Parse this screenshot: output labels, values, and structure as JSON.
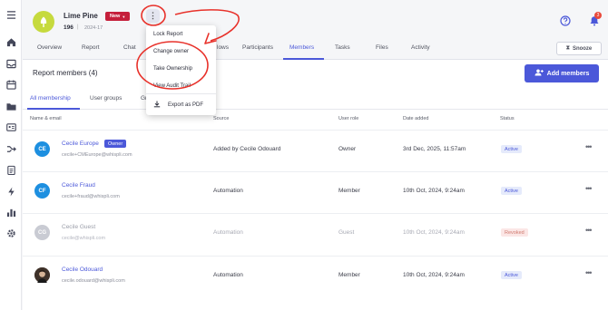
{
  "sidebar": {
    "icons": [
      "menu-icon",
      "home-icon",
      "inbox-icon",
      "calendar-icon",
      "folder-icon",
      "id-card-icon",
      "merge-icon",
      "clipboard-icon",
      "lightning-icon",
      "bar-chart-icon",
      "gear-icon"
    ]
  },
  "header": {
    "title": "Lime Pine",
    "badge": "New",
    "report_number": "196",
    "separator": "|",
    "report_date": "2024-17",
    "notification_count": "3"
  },
  "tabs": [
    {
      "label": "Overview"
    },
    {
      "label": "Report"
    },
    {
      "label": "Chat"
    },
    {
      "label": "lows"
    },
    {
      "label": "Participants"
    },
    {
      "label": "Members"
    },
    {
      "label": "Tasks"
    },
    {
      "label": "Files"
    },
    {
      "label": "Activity"
    }
  ],
  "snooze_label": "Snooze",
  "members": {
    "title": "Report members (4)",
    "add_button": "Add members",
    "subtabs": [
      {
        "label": "All membership"
      },
      {
        "label": "User groups"
      },
      {
        "label": "Gr"
      }
    ],
    "columns": [
      "Name & email",
      "Source",
      "User role",
      "Date added",
      "Status"
    ],
    "rows": [
      {
        "initials": "CE",
        "name": "Cecile Europe",
        "badge": "Owner",
        "email": "cecile+CMEurope@whispli.com",
        "source": "Added by Cecile Odouard",
        "role": "Owner",
        "date": "3rd Dec, 2025, 11:57am",
        "status": "Active",
        "avatar_color": "#1d8fe0"
      },
      {
        "initials": "CF",
        "name": "Cecile Fraud",
        "email": "cecile+fraud@whispli.com",
        "source": "Automation",
        "role": "Member",
        "date": "10th Oct, 2024, 9:24am",
        "status": "Active",
        "avatar_color": "#1d8fe0"
      },
      {
        "initials": "CG",
        "name": "Cecile Guest",
        "email": "cecile@whispli.com",
        "source": "Automation",
        "role": "Guest",
        "date": "10th Oct, 2024, 9:24am",
        "status": "Revoked",
        "avatar_color": "#c9cbd3"
      },
      {
        "initials": "",
        "name": "Cecile Odouard",
        "email": "cecile.odouard@whispli.com",
        "source": "Automation",
        "role": "Member",
        "date": "10th Oct, 2024, 9:24am",
        "status": "Active",
        "avatar_color": "#6b5444"
      }
    ]
  },
  "dropdown": {
    "items": [
      "Lock Report",
      "Change owner",
      "Take Ownership",
      "View Audit Trail"
    ],
    "export_label": "Export as PDF"
  },
  "colors": {
    "accent": "#4b58d9",
    "new_badge": "#c51f3b",
    "annotation": "#e8312a"
  }
}
